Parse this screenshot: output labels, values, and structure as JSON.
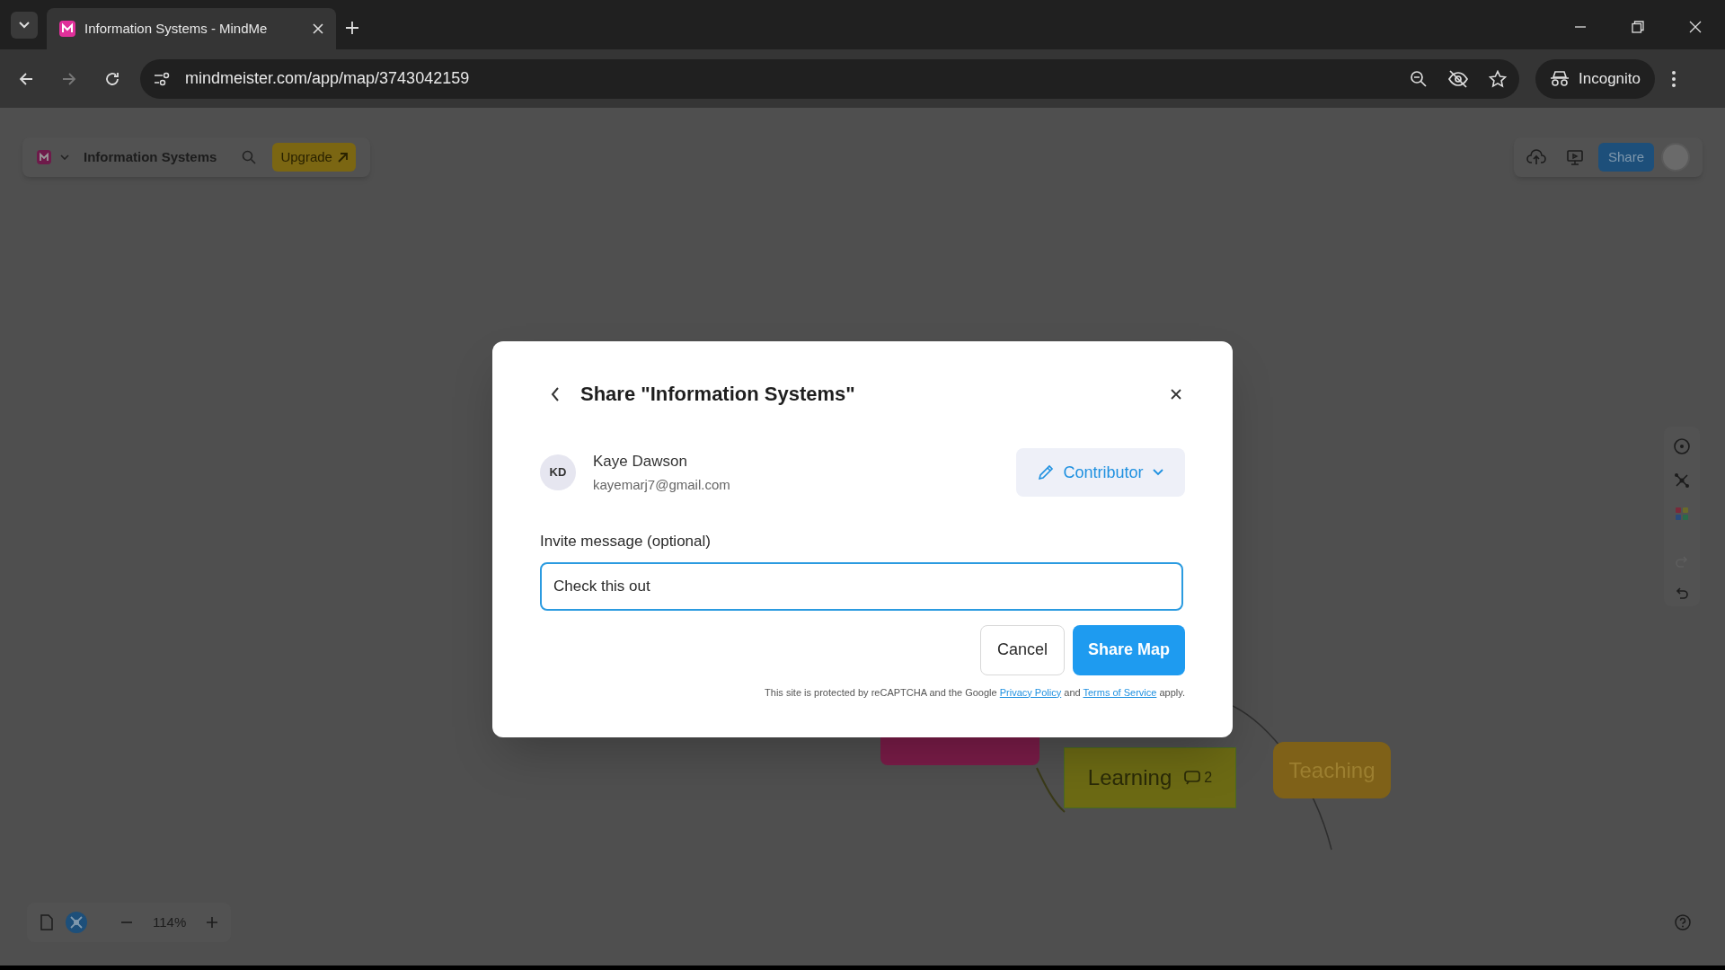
{
  "browser": {
    "tab_title": "Information Systems - MindMe",
    "url": "mindmeister.com/app/map/3743042159",
    "profile": "Incognito"
  },
  "app_toolbar": {
    "map_title": "Information Systems",
    "upgrade": "Upgrade",
    "share": "Share"
  },
  "zoom": {
    "level": "114%"
  },
  "map_nodes": [
    {
      "color": "#7a1c48"
    },
    {
      "label": "Learning",
      "comments": "2",
      "color": "#6c6a14"
    },
    {
      "label": "Teaching",
      "color": "#7f6118"
    }
  ],
  "dialog": {
    "title": "Share \"Information Systems\"",
    "user": {
      "initials": "KD",
      "name": "Kaye Dawson",
      "email": "kayemarj7@gmail.com"
    },
    "role": "Contributor",
    "message_label": "Invite message (optional)",
    "message": "Check this out",
    "cancel": "Cancel",
    "submit": "Share Map",
    "notice": {
      "before": "This site is protected by reCAPTCHA and the Google",
      "link_1": "Privacy Policy",
      "middle": "and",
      "link_2": "Terms of Service",
      "after": "apply."
    }
  }
}
